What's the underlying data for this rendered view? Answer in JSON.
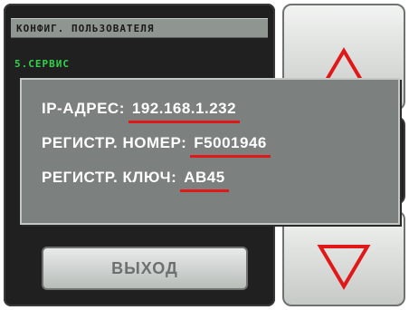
{
  "screen": {
    "header_title": "КОНФИГ. ПОЛЬЗОВАТЕЛЯ",
    "menu_item": "5.СЕРВИС",
    "exit_label": "ВЫХОД"
  },
  "dialog": {
    "ip_label": "IP-АДРЕС:",
    "ip_value": "192.168.1.232",
    "reg_number_label": "РЕГИСТР. НОМЕР:",
    "reg_number_value": "F5001946",
    "reg_key_label": "РЕГИСТР. КЛЮЧ:",
    "reg_key_value": "AB45"
  },
  "colors": {
    "menu_text": "#33d24a",
    "highlight": "#e01818",
    "arrow": "#e01818"
  },
  "icons": {
    "up": "arrow-up-icon",
    "down": "arrow-down-icon"
  }
}
